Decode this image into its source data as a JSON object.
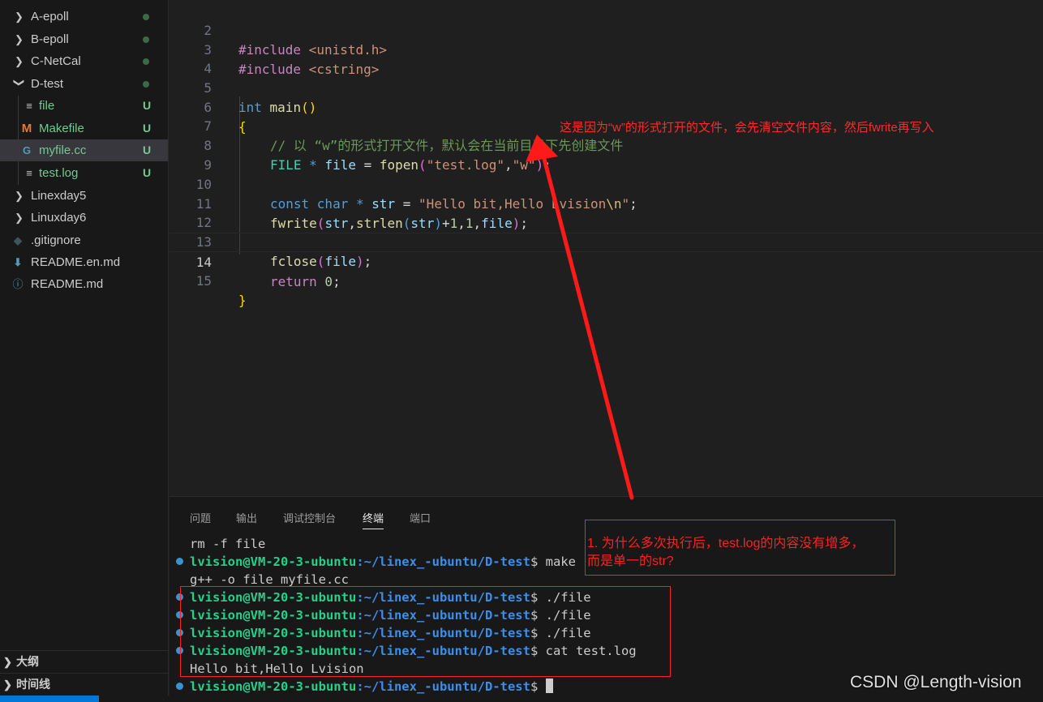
{
  "explorer": {
    "items": [
      {
        "label": "A-epoll",
        "kind": "folder"
      },
      {
        "label": "B-epoll",
        "kind": "folder"
      },
      {
        "label": "C-NetCal",
        "kind": "folder"
      },
      {
        "label": "D-test",
        "kind": "folder-open"
      },
      {
        "label": "file",
        "kind": "file",
        "git": "U"
      },
      {
        "label": "Makefile",
        "kind": "makefile",
        "icon": "M",
        "git": "U"
      },
      {
        "label": "myfile.cc",
        "kind": "cpp",
        "icon": "G",
        "git": "U"
      },
      {
        "label": "test.log",
        "kind": "file",
        "git": "U"
      },
      {
        "label": "Linexday5",
        "kind": "folder"
      },
      {
        "label": "Linuxday6",
        "kind": "folder"
      },
      {
        "label": ".gitignore",
        "kind": "gitignore"
      },
      {
        "label": "README.en.md",
        "kind": "download"
      },
      {
        "label": "README.md",
        "kind": "info"
      }
    ],
    "outline_label": "大纲",
    "timeline_label": "时间线"
  },
  "editor": {
    "active_line": "14",
    "line_numbers": [
      "2",
      "3",
      "4",
      "5",
      "6",
      "7",
      "8",
      "9",
      "10",
      "11",
      "12",
      "13",
      "14",
      "15"
    ],
    "tokens": {
      "l2_pre": "#include",
      "l2_inc": " <unistd.h>",
      "l3_pre": "#include",
      "l3_inc": " <cstring>",
      "l5_kw": "int",
      "l5_fn": " main",
      "l5_p": "()",
      "l6_b": "{",
      "l7_cmt": "// 以 “w”的形式打开文件，默认会在当前目录下先创建文件",
      "l8_type": "FILE",
      "l8_star": " * ",
      "l8_var": "file",
      "l8_eq": " = ",
      "l8_fn": "fopen",
      "l8_p1": "(",
      "l8_s1": "\"test.log\"",
      "l8_c": ",",
      "l8_s2": "\"w\"",
      "l8_p2": ")",
      "l8_end": ";",
      "l10_kw": "const char",
      "l10_star": " * ",
      "l10_var": "str",
      "l10_eq": " = ",
      "l10_s": "\"Hello bit,Hello Lvision",
      "l10_esc": "\\n",
      "l10_q": "\"",
      "l10_end": ";",
      "l11_fn": "fwrite",
      "l11_p1": "(",
      "l11_a1": "str",
      "l11_c1": ",",
      "l11_fn2": "strlen",
      "l11_p3": "(",
      "l11_a2": "str",
      "l11_p4": ")",
      "l11_plus": "+",
      "l11_n1": "1",
      "l11_c2": ",",
      "l11_n2": "1",
      "l11_c3": ",",
      "l11_a3": "file",
      "l11_p2": ")",
      "l11_end": ";",
      "l13_fn": "fclose",
      "l13_p1": "(",
      "l13_a": "file",
      "l13_p2": ")",
      "l13_end": ";",
      "l14_ctl": "return",
      "l14_n": " 0",
      "l14_end": ";",
      "l15_b": "}"
    },
    "inline_annotation": "这是因为“w”的形式打开的文件，会先清空文件内容，然后fwrite再写入"
  },
  "panel": {
    "tabs": [
      "问题",
      "输出",
      "调试控制台",
      "终端",
      "端口"
    ],
    "active_tab": "终端",
    "prompt_user": "lvision@VM-20-3-ubuntu",
    "prompt_path": ":~/linex_-ubuntu/D-test",
    "prompt_sign": "$ ",
    "lines": {
      "l0": "rm -f file",
      "l1_cmd": "make",
      "l2": "g++ -o file myfile.cc",
      "l3_cmd": "./file",
      "l4_cmd": "./file",
      "l5_cmd": "./file",
      "l6_cmd": "cat test.log",
      "l7": "Hello bit,Hello Lvision"
    },
    "question_line1": "1. 为什么多次执行后，test.log的内容没有增多，",
    "question_line2": "而是单一的str?"
  },
  "watermark": "CSDN @Length-vision",
  "colors": {
    "annotation_red": "#ff2020",
    "prompt_green": "#23d18b",
    "prompt_blue": "#3b8eea",
    "git_untracked": "#73c991"
  }
}
